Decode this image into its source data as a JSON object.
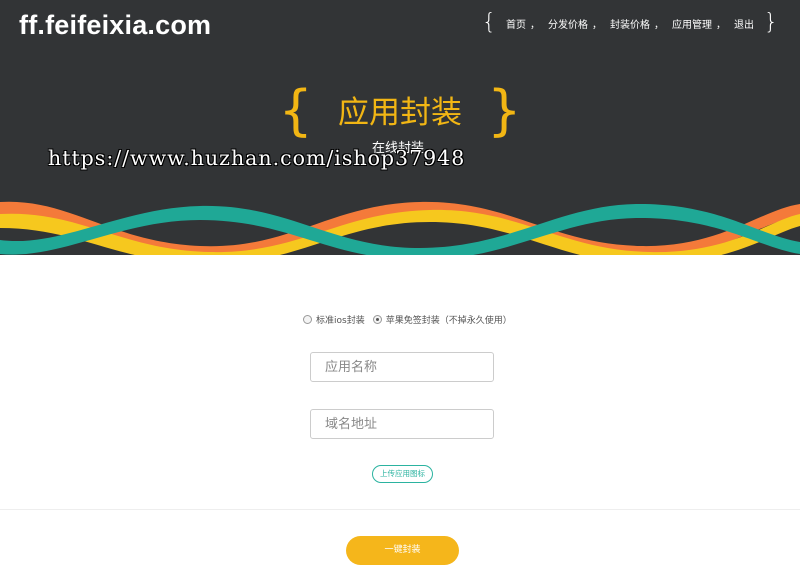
{
  "header": {
    "logo": "ff.feifeixia.com",
    "nav": {
      "open_brace": "{",
      "close_brace": "}",
      "items": [
        {
          "label": "首页"
        },
        {
          "label": "分发价格"
        },
        {
          "label": "封装价格"
        },
        {
          "label": "应用管理"
        },
        {
          "label": "退出"
        }
      ],
      "separator": "，"
    },
    "hero": {
      "open_brace": "{",
      "title": "应用封装",
      "close_brace": "}",
      "subtitle": "在线封装"
    },
    "watermark": "https://www.huzhan.com/ishop37948"
  },
  "colors": {
    "header_bg": "#323436",
    "accent_yellow": "#f2b614",
    "wave_teal": "#1fa896",
    "wave_orange": "#f47a3a",
    "wave_yellow": "#f6c81e",
    "button_yellow": "#f5b61b",
    "upload_teal": "#2bb3a0"
  },
  "form": {
    "options": [
      {
        "label": "标准ios封装",
        "checked": false
      },
      {
        "label": "苹果免签封装（不掉永久使用）",
        "checked": true
      }
    ],
    "app_name": {
      "placeholder": "应用名称",
      "value": ""
    },
    "domain": {
      "placeholder": "域名地址",
      "value": ""
    },
    "upload_label": "上传应用图标",
    "submit_label": "一键封装"
  }
}
